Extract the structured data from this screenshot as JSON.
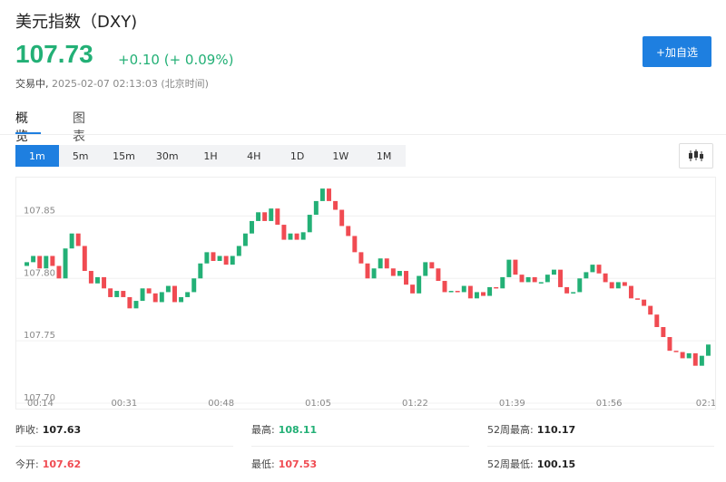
{
  "header": {
    "title": "美元指数（DXY)",
    "price": "107.73",
    "change": "+0.10 (+ 0.09%)",
    "status_label": "交易中,",
    "status_time": "2025-02-07 02:13:03  (北京时间)",
    "watch_label": "+加自选"
  },
  "tabs": [
    {
      "label": "概览",
      "active": true
    },
    {
      "label": "图表",
      "active": false
    }
  ],
  "intervals": [
    {
      "label": "1m",
      "active": true
    },
    {
      "label": "5m"
    },
    {
      "label": "15m"
    },
    {
      "label": "30m"
    },
    {
      "label": "1H"
    },
    {
      "label": "4H"
    },
    {
      "label": "1D"
    },
    {
      "label": "1W"
    },
    {
      "label": "1M"
    }
  ],
  "chart_type_icon": "candlestick-icon",
  "colors": {
    "up": "#23b076",
    "down": "#f04b52",
    "accent": "#1e7fe0"
  },
  "chart_data": {
    "type": "candlestick",
    "y_ticks": [
      "107.85",
      "107.80",
      "107.75",
      "107.70"
    ],
    "y_values": [
      107.85,
      107.8,
      107.75,
      107.7
    ],
    "x_ticks": [
      "00:14",
      "00:31",
      "00:48",
      "01:05",
      "01:22",
      "01:39",
      "01:56",
      "02:1"
    ],
    "ylim": [
      107.7,
      107.875
    ],
    "closes": [
      107.813,
      107.818,
      107.808,
      107.818,
      107.81,
      107.8,
      107.824,
      107.836,
      107.826,
      107.806,
      107.796,
      107.801,
      107.792,
      107.785,
      107.79,
      107.785,
      107.776,
      107.782,
      107.792,
      107.788,
      107.781,
      107.789,
      107.794,
      107.781,
      107.785,
      107.789,
      107.8,
      107.812,
      107.821,
      107.814,
      107.818,
      107.811,
      107.818,
      107.826,
      107.836,
      107.846,
      107.853,
      107.846,
      107.856,
      107.843,
      107.831,
      107.836,
      107.831,
      107.837,
      107.851,
      107.862,
      107.872,
      107.862,
      107.855,
      107.842,
      107.834,
      107.821,
      107.812,
      107.8,
      107.808,
      107.816,
      107.808,
      107.802,
      107.806,
      107.795,
      107.788,
      107.802,
      107.813,
      107.808,
      107.798,
      107.789,
      107.79,
      107.789,
      107.794,
      107.784,
      107.789,
      107.786,
      107.793,
      107.792,
      107.801,
      107.815,
      107.803,
      107.797,
      107.801,
      107.797,
      107.797,
      107.803,
      107.807,
      107.793,
      107.788,
      107.789,
      107.8,
      107.805,
      107.811,
      107.804,
      107.797,
      107.792,
      107.797,
      107.794,
      107.784,
      107.783,
      107.778,
      107.771,
      107.761,
      107.753,
      107.742,
      107.741,
      107.736,
      107.74,
      107.73,
      107.738,
      107.747
    ]
  },
  "stats": [
    {
      "label": "昨收:",
      "value": "107.63",
      "color": "#222"
    },
    {
      "label": "最高:",
      "value": "108.11",
      "color": "#23b076"
    },
    {
      "label": "52周最高:",
      "value": "110.17",
      "color": "#222"
    },
    {
      "label": "今开:",
      "value": "107.62",
      "color": "#f04b52"
    },
    {
      "label": "最低:",
      "value": "107.53",
      "color": "#f04b52"
    },
    {
      "label": "52周最低:",
      "value": "100.15",
      "color": "#222"
    }
  ]
}
